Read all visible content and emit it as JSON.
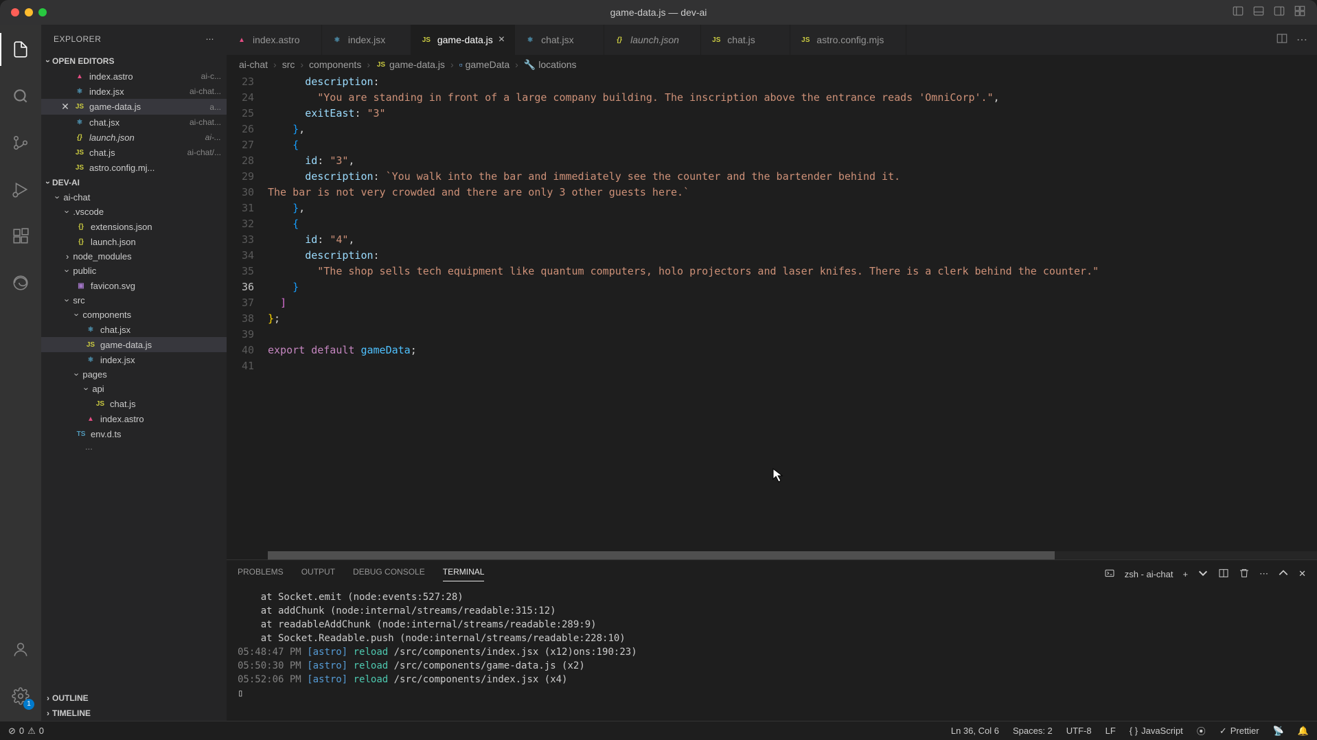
{
  "titlebar": {
    "title": "game-data.js — dev-ai"
  },
  "sidebar": {
    "title": "EXPLORER",
    "sections": {
      "open_editors": "OPEN EDITORS",
      "workspace": "DEV-AI",
      "outline": "OUTLINE",
      "timeline": "TIMELINE"
    },
    "open_editors": [
      {
        "name": "index.astro",
        "hint": "ai-c...",
        "icon": "astro"
      },
      {
        "name": "index.jsx",
        "hint": "ai-chat...",
        "icon": "jsx"
      },
      {
        "name": "game-data.js",
        "hint": "a...",
        "icon": "js",
        "active": true
      },
      {
        "name": "chat.jsx",
        "hint": "ai-chat...",
        "icon": "jsx"
      },
      {
        "name": "launch.json",
        "hint": "ai-...",
        "icon": "json",
        "italic": true
      },
      {
        "name": "chat.js",
        "hint": "ai-chat/...",
        "icon": "js"
      },
      {
        "name": "astro.config.mj...",
        "hint": "",
        "icon": "js"
      }
    ],
    "tree": {
      "ai_chat": "ai-chat",
      "vscode": ".vscode",
      "extensions_json": "extensions.json",
      "launch_json": "launch.json",
      "node_modules": "node_modules",
      "public": "public",
      "favicon": "favicon.svg",
      "src": "src",
      "components": "components",
      "chat_jsx": "chat.jsx",
      "game_data_js": "game-data.js",
      "index_jsx": "index.jsx",
      "pages": "pages",
      "api": "api",
      "chat_js": "chat.js",
      "index_astro": "index.astro",
      "env_d_ts": "env.d.ts"
    }
  },
  "tabs": [
    {
      "label": "index.astro",
      "icon": "astro"
    },
    {
      "label": "index.jsx",
      "icon": "jsx"
    },
    {
      "label": "game-data.js",
      "icon": "js",
      "active": true
    },
    {
      "label": "chat.jsx",
      "icon": "jsx"
    },
    {
      "label": "launch.json",
      "icon": "json",
      "italic": true
    },
    {
      "label": "chat.js",
      "icon": "js"
    },
    {
      "label": "astro.config.mjs",
      "icon": "js"
    }
  ],
  "breadcrumbs": {
    "parts": [
      "ai-chat",
      "src",
      "components",
      "game-data.js",
      "gameData",
      "locations"
    ]
  },
  "editor": {
    "first_line": 23,
    "active_line": 36,
    "lines": [
      {
        "n": 23,
        "html": "      <span class='tok-prop'>description</span>:"
      },
      {
        "n": 24,
        "html": "        <span class='tok-str'>\"You are standing in front of a large company building. The inscription above the entrance reads 'OmniCorp'.\"</span>,"
      },
      {
        "n": 25,
        "html": "      <span class='tok-prop'>exitEast</span>: <span class='tok-str'>\"3\"</span>"
      },
      {
        "n": 26,
        "html": "    <span class='bracket3'>}</span>,"
      },
      {
        "n": 27,
        "html": "    <span class='bracket3'>{</span>"
      },
      {
        "n": 28,
        "html": "      <span class='tok-prop'>id</span>: <span class='tok-str'>\"3\"</span>,"
      },
      {
        "n": 29,
        "html": "      <span class='tok-prop'>description</span>: <span class='tok-tstr'>`You walk into the bar and immediately see the counter and the bartender behind it.</span>"
      },
      {
        "n": 30,
        "html": "<span class='tok-tstr'>The bar is not very crowded and there are only 3 other guests here.`</span>"
      },
      {
        "n": 31,
        "html": "    <span class='bracket3'>}</span>,"
      },
      {
        "n": 32,
        "html": "    <span class='bracket3'>{</span>"
      },
      {
        "n": 33,
        "html": "      <span class='tok-prop'>id</span>: <span class='tok-str'>\"4\"</span>,"
      },
      {
        "n": 34,
        "html": "      <span class='tok-prop'>description</span>:"
      },
      {
        "n": 35,
        "html": "        <span class='tok-str'>\"The shop sells tech equipment like quantum computers, holo projectors and laser knifes. There is a clerk behind the counter.\"</span>"
      },
      {
        "n": 36,
        "html": "    <span class='bracket3'>}</span>"
      },
      {
        "n": 37,
        "html": "  <span class='bracket2'>]</span>"
      },
      {
        "n": 38,
        "html": "<span class='bracket1'>}</span>;"
      },
      {
        "n": 39,
        "html": ""
      },
      {
        "n": 40,
        "html": "<span class='tok-key'>export</span> <span class='tok-key'>default</span> <span class='tok-fn'>gameData</span>;"
      },
      {
        "n": 41,
        "html": ""
      }
    ]
  },
  "panel": {
    "tabs": {
      "problems": "PROBLEMS",
      "output": "OUTPUT",
      "debug": "DEBUG CONSOLE",
      "terminal": "TERMINAL"
    },
    "shell_label": "zsh - ai-chat",
    "terminal_lines": [
      {
        "raw": "    at Socket.emit (node:events:527:28)"
      },
      {
        "raw": "    at addChunk (node:internal/streams/readable:315:12)"
      },
      {
        "raw": "    at readableAddChunk (node:internal/streams/readable:289:9)"
      },
      {
        "raw": "    at Socket.Readable.push (node:internal/streams/readable:228:10)"
      },
      {
        "time": "05:48:47 PM",
        "tag": "[astro]",
        "action": "reload",
        "rest": "/src/components/index.jsx (x12)ons:190:23)"
      },
      {
        "time": "05:50:30 PM",
        "tag": "[astro]",
        "action": "reload",
        "rest": "/src/components/game-data.js (x2)"
      },
      {
        "time": "05:52:06 PM",
        "tag": "[astro]",
        "action": "reload",
        "rest": "/src/components/index.jsx (x4)"
      }
    ],
    "prompt": "▯"
  },
  "statusbar": {
    "errors": "0",
    "warnings": "0",
    "position": "Ln 36, Col 6",
    "spaces": "Spaces: 2",
    "encoding": "UTF-8",
    "eol": "LF",
    "language": "JavaScript",
    "prettier": "Prettier"
  },
  "activity": {
    "settings_badge": "1"
  }
}
